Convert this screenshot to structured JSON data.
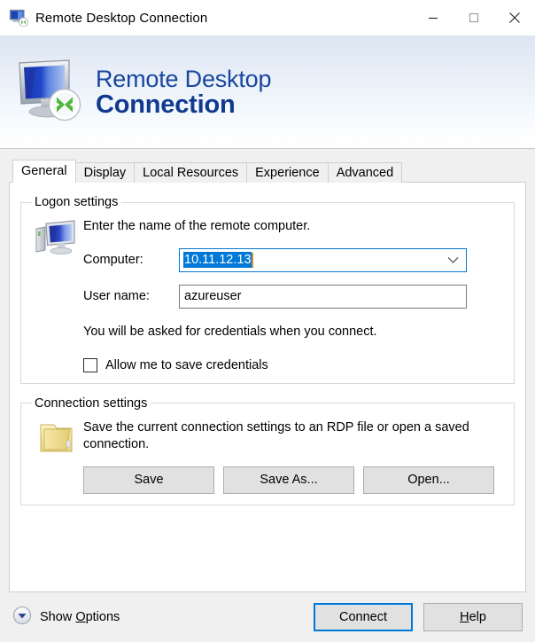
{
  "window": {
    "title": "Remote Desktop Connection",
    "icon": "remote-desktop-icon",
    "controls": {
      "minimize": "minimize-icon",
      "maximize": "maximize-icon",
      "close": "close-icon"
    }
  },
  "banner": {
    "line1": "Remote Desktop",
    "line2": "Connection",
    "icon": "monitor-with-connection-badge-icon",
    "text_color": "#19469d",
    "bold_color": "#10398f"
  },
  "tabs": [
    {
      "label": "General",
      "active": true
    },
    {
      "label": "Display",
      "active": false
    },
    {
      "label": "Local Resources",
      "active": false
    },
    {
      "label": "Experience",
      "active": false
    },
    {
      "label": "Advanced",
      "active": false
    }
  ],
  "logon_settings": {
    "legend": "Logon settings",
    "icon": "desktop-computer-icon",
    "description": "Enter the name of the remote computer.",
    "computer": {
      "label": "Computer:",
      "value": "10.11.12.13",
      "selected": true,
      "selection_color": "#0078d7",
      "focus_border_color": "#0078d7",
      "dropdown_icon": "chevron-down-icon"
    },
    "username": {
      "label": "User name:",
      "value": "azureuser"
    },
    "credentials_note": "You will be asked for credentials when you connect.",
    "save_credentials": {
      "label": "Allow me to save credentials",
      "checked": false
    }
  },
  "connection_settings": {
    "legend": "Connection settings",
    "icon": "folder-icon",
    "description": "Save the current connection settings to an RDP file or open a saved connection.",
    "buttons": [
      {
        "label": "Save"
      },
      {
        "label": "Save As..."
      },
      {
        "label": "Open..."
      }
    ]
  },
  "bottom_bar": {
    "show_options": {
      "label_before": "Show ",
      "accelerator": "O",
      "label_after": "ptions",
      "icon": "chevron-down-circle-icon"
    },
    "connect": {
      "label": "Connect",
      "is_default": true,
      "focus_color": "#0078d7"
    },
    "help": {
      "accelerator": "H",
      "label_after": "elp"
    }
  }
}
